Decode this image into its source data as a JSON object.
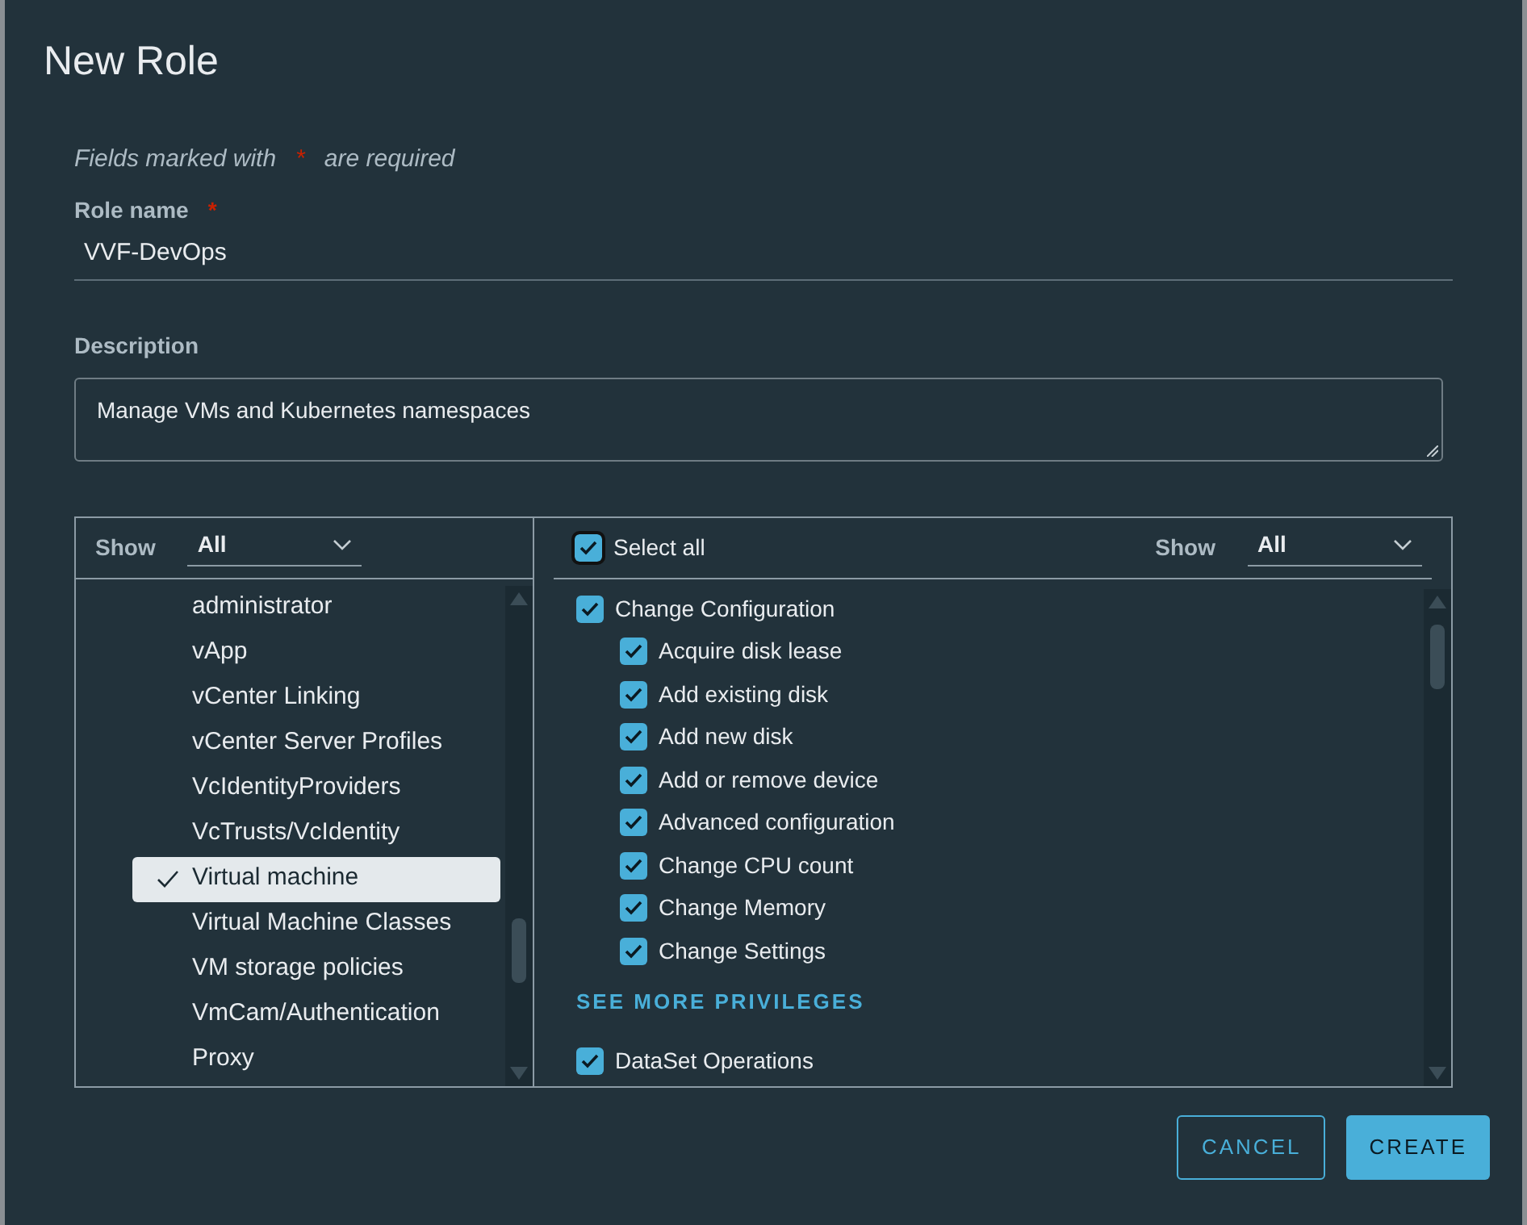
{
  "dialog": {
    "title": "New Role"
  },
  "required_note": {
    "before": "Fields marked with",
    "mark": "*",
    "after": "are required"
  },
  "role_name": {
    "label": "Role name",
    "required_mark": "*",
    "value": "VVF-DevOps"
  },
  "description": {
    "label": "Description",
    "value": "Manage VMs and Kubernetes namespaces"
  },
  "categories": {
    "filter": {
      "label": "Show",
      "value": "All"
    },
    "items": [
      {
        "label": "administrator",
        "selected": false
      },
      {
        "label": "vApp",
        "selected": false
      },
      {
        "label": "vCenter Linking",
        "selected": false
      },
      {
        "label": "vCenter Server Profiles",
        "selected": false
      },
      {
        "label": "VcIdentityProviders",
        "selected": false
      },
      {
        "label": "VcTrusts/VcIdentity",
        "selected": false
      },
      {
        "label": "Virtual machine",
        "selected": true
      },
      {
        "label": "Virtual Machine Classes",
        "selected": false
      },
      {
        "label": "VM storage policies",
        "selected": false
      },
      {
        "label": "VmCam/Authentication",
        "selected": false
      },
      {
        "label": "Proxy",
        "selected": false
      }
    ]
  },
  "privileges": {
    "select_all": {
      "label": "Select all",
      "checked": true
    },
    "filter": {
      "label": "Show",
      "value": "All"
    },
    "groups": [
      {
        "label": "Change Configuration",
        "checked": true,
        "link": "SEE MORE PRIVILEGES",
        "children": [
          {
            "label": "Acquire disk lease",
            "checked": true
          },
          {
            "label": "Add existing disk",
            "checked": true
          },
          {
            "label": "Add new disk",
            "checked": true
          },
          {
            "label": "Add or remove device",
            "checked": true
          },
          {
            "label": "Advanced configuration",
            "checked": true
          },
          {
            "label": "Change CPU count",
            "checked": true
          },
          {
            "label": "Change Memory",
            "checked": true
          },
          {
            "label": "Change Settings",
            "checked": true
          }
        ]
      },
      {
        "label": "DataSet Operations",
        "checked": true
      }
    ]
  },
  "buttons": [
    {
      "label": "CANCEL",
      "kind": "secondary"
    },
    {
      "label": "CREATE",
      "kind": "primary"
    }
  ]
}
